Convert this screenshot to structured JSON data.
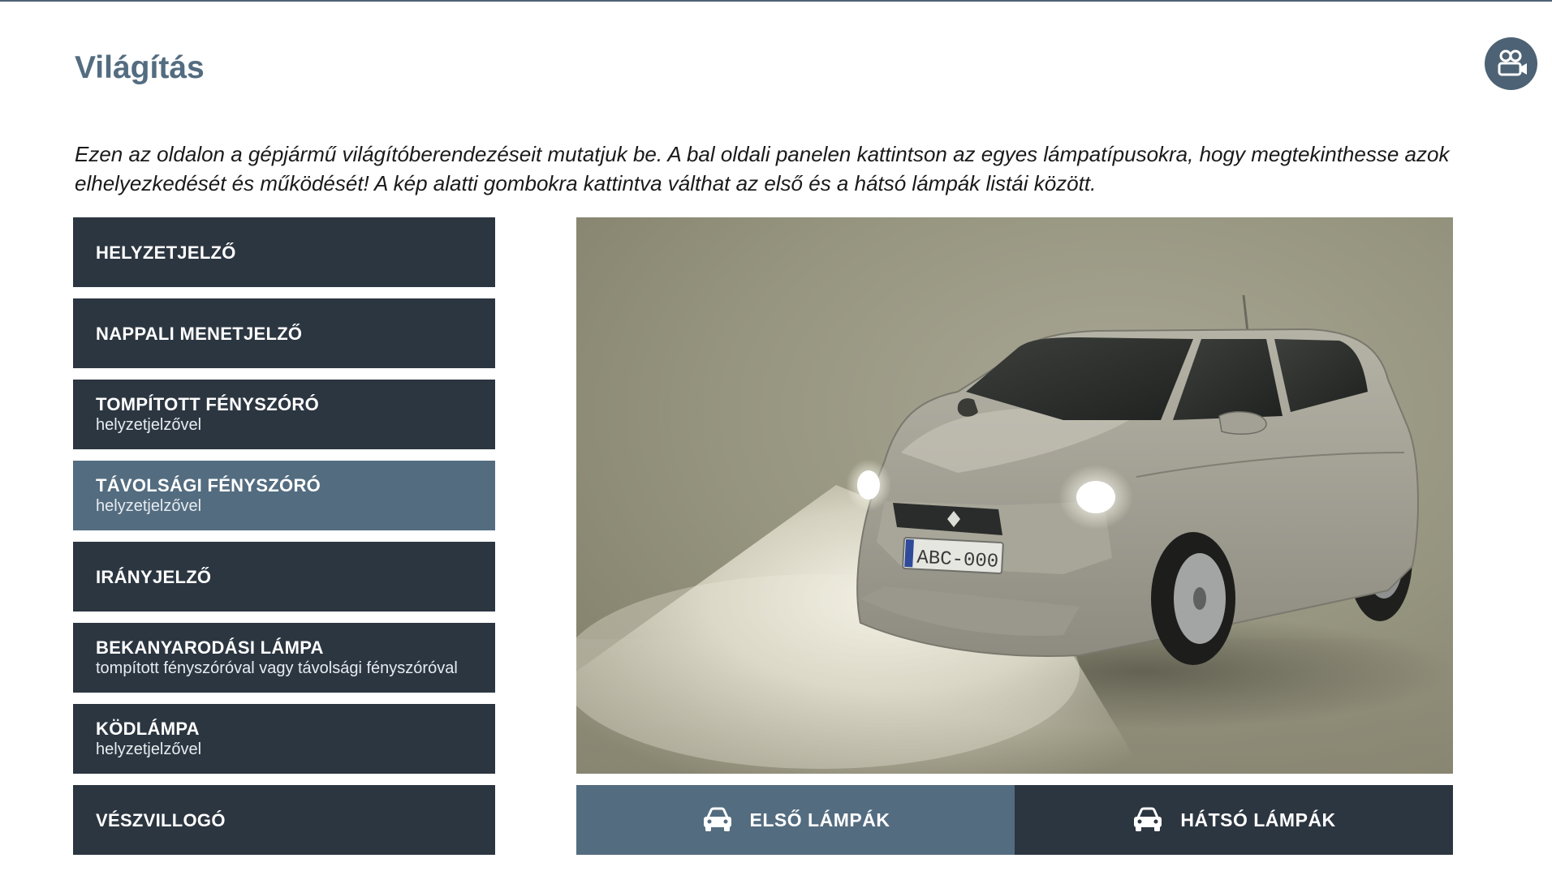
{
  "page": {
    "title": "Világítás",
    "intro": "Ezen az oldalon a gépjármű világítóberendezéseit mutatjuk be. A bal oldali panelen kattintson az egyes lámpatípusokra, hogy megtekinthesse azok elhelyezkedését és működését! A kép alatti gombokra kattintva válthat az első és a hátsó lámpák listái között."
  },
  "lamps": [
    {
      "title": "HELYZETJELZŐ",
      "sub": ""
    },
    {
      "title": "NAPPALI MENETJELZŐ",
      "sub": ""
    },
    {
      "title": "TOMPÍTOTT FÉNYSZÓRÓ",
      "sub": "helyzetjelzővel"
    },
    {
      "title": "TÁVOLSÁGI FÉNYSZÓRÓ",
      "sub": "helyzetjelzővel"
    },
    {
      "title": "IRÁNYJELZŐ",
      "sub": ""
    },
    {
      "title": "BEKANYARODÁSI LÁMPA",
      "sub": "tompított fényszóróval vagy távolsági fényszóróval"
    },
    {
      "title": "KÖDLÁMPA",
      "sub": "helyzetjelzővel"
    },
    {
      "title": "VÉSZVILLOGÓ",
      "sub": ""
    }
  ],
  "active_lamp": "TÁVOLSÁGI FÉNYSZÓRÓ",
  "car": {
    "plate": "ABC-000",
    "icon": "car-illustration"
  },
  "switch": {
    "front_label": "ELSŐ LÁMPÁK",
    "rear_label": "HÁTSÓ LÁMPÁK",
    "active": "front"
  },
  "icons": {
    "media": "video-call-icon",
    "car": "car-icon"
  },
  "colors": {
    "accent": "#536c80",
    "dark": "#2c3641",
    "backdrop": "#9a9987"
  }
}
